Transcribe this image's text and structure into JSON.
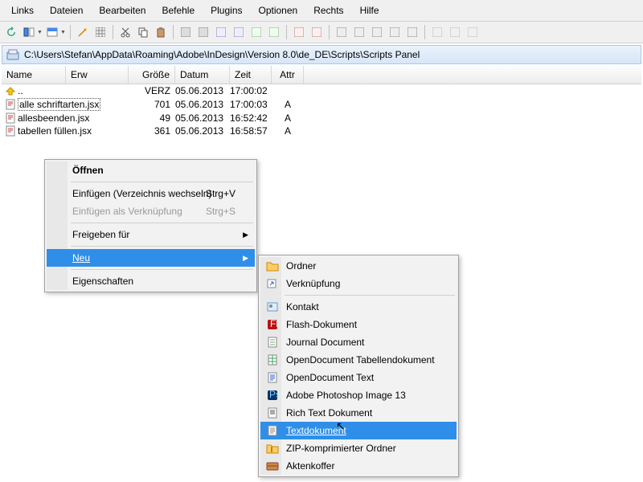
{
  "menubar": [
    "Links",
    "Dateien",
    "Bearbeiten",
    "Befehle",
    "Plugins",
    "Optionen",
    "Rechts",
    "Hilfe"
  ],
  "path": "C:\\Users\\Stefan\\AppData\\Roaming\\Adobe\\InDesign\\Version 8.0\\de_DE\\Scripts\\Scripts Panel",
  "headers": {
    "name": "Name",
    "erw": "Erw",
    "groesse": "Größe",
    "datum": "Datum",
    "zeit": "Zeit",
    "attr": "Attr"
  },
  "rows": [
    {
      "icon": "up",
      "name": "..",
      "groesse": "VERZ",
      "datum": "05.06.2013",
      "zeit": "17:00:02",
      "attr": ""
    },
    {
      "icon": "jsx",
      "name": "alle schriftarten.jsx",
      "sel": true,
      "groesse": "701",
      "datum": "05.06.2013",
      "zeit": "17:00:03",
      "attr": "A"
    },
    {
      "icon": "jsx",
      "name": "allesbeenden.jsx",
      "groesse": "49",
      "datum": "05.06.2013",
      "zeit": "16:52:42",
      "attr": "A"
    },
    {
      "icon": "jsx",
      "name": "tabellen füllen.jsx",
      "groesse": "361",
      "datum": "05.06.2013",
      "zeit": "16:58:57",
      "attr": "A"
    }
  ],
  "ctx": {
    "open": "Öffnen",
    "einfuegen": "Einfügen (Verzeichnis wechseln)",
    "einfuegenShort": "Strg+V",
    "einfuegenLink": "Einfügen als Verknüpfung",
    "einfuegenLinkShort": "Strg+S",
    "freigeben": "Freigeben für",
    "neu": "Neu",
    "eigenschaften": "Eigenschaften"
  },
  "sub": [
    {
      "icon": "folder",
      "label": "Ordner"
    },
    {
      "icon": "link",
      "label": "Verknüpfung"
    },
    {
      "sep": true
    },
    {
      "icon": "contact",
      "label": "Kontakt"
    },
    {
      "icon": "flash",
      "label": "Flash-Dokument"
    },
    {
      "icon": "journal",
      "label": "Journal Document"
    },
    {
      "icon": "ods",
      "label": "OpenDocument Tabellendokument"
    },
    {
      "icon": "odt",
      "label": "OpenDocument Text"
    },
    {
      "icon": "ps",
      "label": "Adobe Photoshop Image 13"
    },
    {
      "icon": "rtf",
      "label": "Rich Text Dokument"
    },
    {
      "icon": "txt",
      "label": "Textdokument",
      "hi": true
    },
    {
      "icon": "zip",
      "label": "ZIP-komprimierter Ordner"
    },
    {
      "icon": "brief",
      "label": "Aktenkoffer"
    }
  ]
}
